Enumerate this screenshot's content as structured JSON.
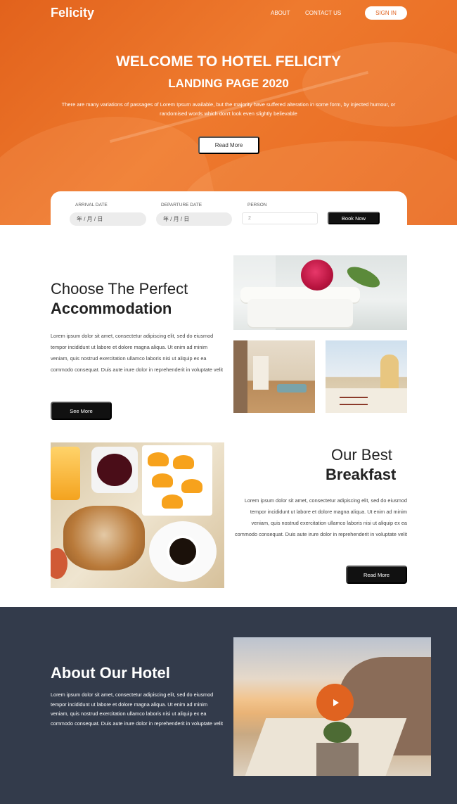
{
  "nav": {
    "logo": "Felicity",
    "about": "ABOUT",
    "contact": "CONTACT US",
    "signin": "SIGN IN"
  },
  "hero": {
    "title": "WELCOME TO HOTEL FELICITY",
    "subtitle": "LANDING PAGE 2020",
    "text": "There are many variations of passages of Lorem Ipsum available, but the majority have suffered alteration in some form, by injected humour, or randomised words which don't look even slightly believable",
    "button": "Read More"
  },
  "booking": {
    "arrival_label": "ARRIVAL DATE",
    "arrival_value": "年 / 月 / 日",
    "departure_label": "DEPARTURE DATE",
    "departure_value": "年 / 月 / 日",
    "person_label": "PERSON",
    "person_value": "2",
    "button": "Book Now"
  },
  "accommodation": {
    "title_light": "Choose The Perfect",
    "title_bold": "Accommodation",
    "text": "Lorem ipsum dolor sit amet, consectetur adipiscing elit, sed do eiusmod tempor incididunt ut labore et dolore magna aliqua. Ut enim ad minim veniam, quis nostrud exercitation ullamco laboris nisi ut aliquip ex ea commodo consequat. Duis aute irure dolor in reprehenderit in voluptate velit",
    "button": "See More"
  },
  "breakfast": {
    "title_light": "Our Best",
    "title_bold": "Breakfast",
    "text": "Lorem ipsum dolor sit amet, consectetur adipiscing elit, sed do eiusmod tempor incididunt ut labore et dolore magna aliqua. Ut enim ad minim veniam, quis nostrud exercitation ullamco laboris nisi ut aliquip ex ea commodo consequat. Duis aute irure dolor in reprehenderit in voluptate velit",
    "button": "Read More"
  },
  "about": {
    "title": "About Our Hotel",
    "text": "Lorem ipsum dolor sit amet, consectetur adipiscing elit, sed do eiusmod tempor incididunt ut labore et dolore magna aliqua. Ut enim ad minim veniam, quis nostrud exercitation ullamco laboris nisi ut aliquip ex ea commodo consequat. Duis aute irure dolor in reprehenderit in voluptate velit"
  },
  "icons": {
    "play": "play-icon"
  },
  "colors": {
    "accent": "#e0601c",
    "dark": "#111111",
    "about_bg": "#333b4b"
  }
}
